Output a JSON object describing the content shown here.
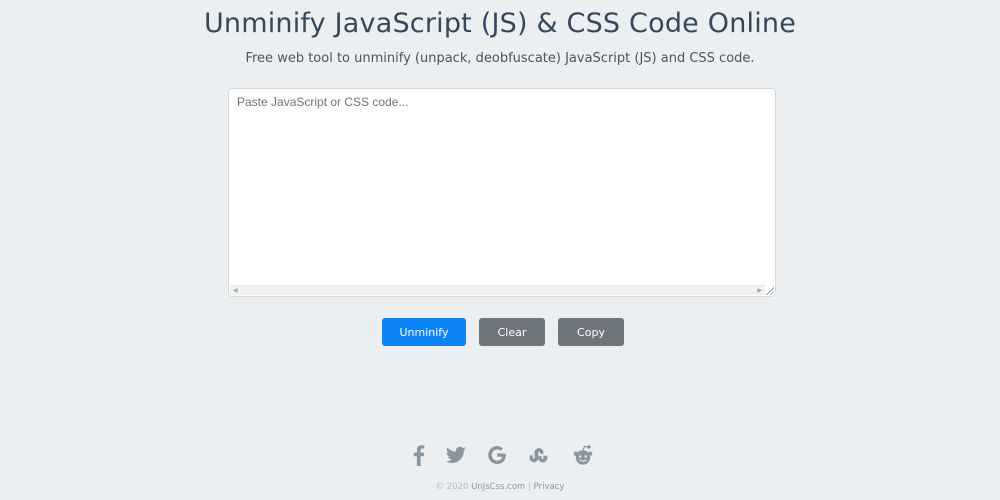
{
  "header": {
    "title": "Unminify JavaScript (JS) & CSS Code Online",
    "subtitle": "Free web tool to unminify (unpack, deobfuscate) JavaScript (JS) and CSS code."
  },
  "editor": {
    "placeholder": "Paste JavaScript or CSS code...",
    "value": ""
  },
  "buttons": {
    "unminify_label": "Unminify",
    "clear_label": "Clear",
    "copy_label": "Copy"
  },
  "social": {
    "icons": [
      "facebook-icon",
      "twitter-icon",
      "google-icon",
      "stumbleupon-icon",
      "reddit-icon"
    ],
    "color": "#8a969f"
  },
  "footer": {
    "copyright": "© 2020",
    "site_link": "UnJsCss.com",
    "separator": "|",
    "privacy_link": "Privacy"
  },
  "colors": {
    "background": "#eceff1",
    "primary": "#0d84f5",
    "secondary": "#6f757c",
    "title": "#34495e"
  }
}
